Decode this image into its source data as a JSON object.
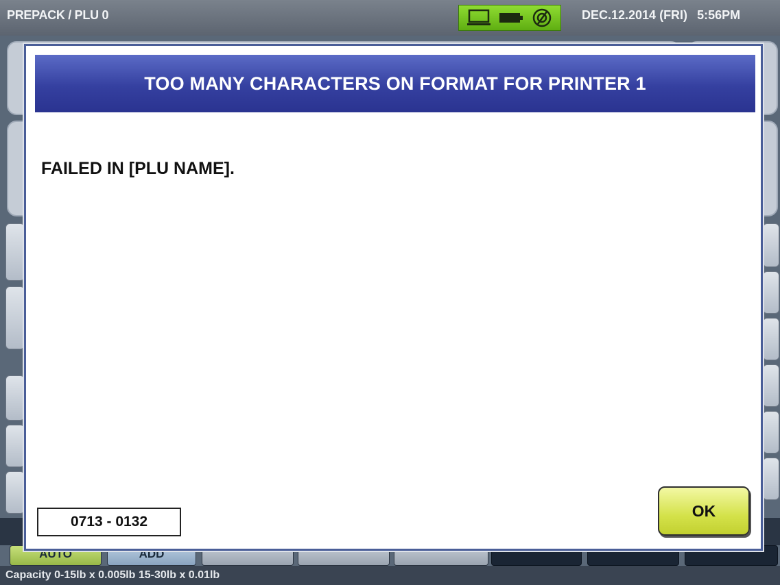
{
  "header": {
    "mode_title": "PREPACK / PLU 0",
    "status_icons": [
      "monitor-icon",
      "battery-icon",
      "network-icon"
    ],
    "date": "DEC.12.2014 (FRI)",
    "time": "5:56PM"
  },
  "function_keys": [
    {
      "label": "AUTO"
    },
    {
      "label": "ADD"
    }
  ],
  "footer": {
    "capacity": "Capacity 0-15lb x 0.005lb  15-30lb x 0.01lb"
  },
  "dialog": {
    "title": "TOO MANY CHARACTERS ON FORMAT FOR PRINTER 1",
    "message": "FAILED IN [PLU NAME].",
    "error_code": "0713 - 0132",
    "ok_label": "OK"
  },
  "colors": {
    "dialog_header": "#3540a0",
    "ok_button": "#d4e24a",
    "status_icons_bg": "#7cc82a",
    "auto_key": "#b5d064",
    "add_key": "#a3bad4"
  }
}
